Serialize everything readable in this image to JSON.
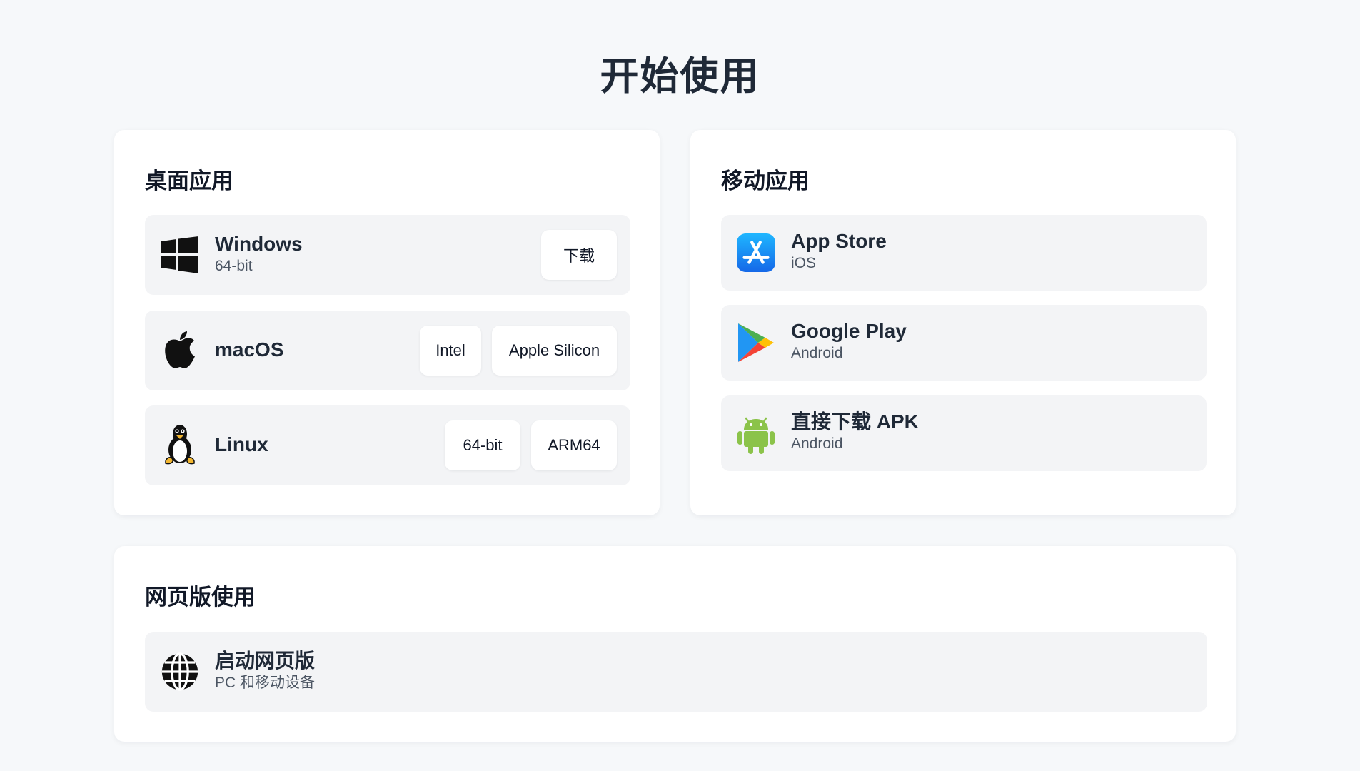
{
  "page_title": "开始使用",
  "desktop": {
    "title": "桌面应用",
    "windows": {
      "icon": "windows-icon",
      "name": "Windows",
      "sub": "64-bit",
      "download_label": "下载"
    },
    "macos": {
      "icon": "apple-icon",
      "name": "macOS",
      "intel_label": "Intel",
      "apple_silicon_label": "Apple Silicon"
    },
    "linux": {
      "icon": "linux-tux-icon",
      "name": "Linux",
      "x64_label": "64-bit",
      "arm64_label": "ARM64"
    }
  },
  "mobile": {
    "title": "移动应用",
    "app_store": {
      "icon": "app-store-icon",
      "name": "App Store",
      "sub": "iOS"
    },
    "google_play": {
      "icon": "google-play-icon",
      "name": "Google Play",
      "sub": "Android"
    },
    "apk": {
      "icon": "android-icon",
      "name": "直接下载 APK",
      "sub": "Android"
    }
  },
  "web": {
    "title": "网页版使用",
    "launch": {
      "icon": "globe-icon",
      "name": "启动网页版",
      "sub": "PC 和移动设备"
    }
  },
  "colors": {
    "background": "#f6f8fa",
    "card": "#ffffff",
    "row": "#f3f4f6",
    "app_store_blue": "#1a8cf7",
    "android_green": "#8bc34a"
  }
}
